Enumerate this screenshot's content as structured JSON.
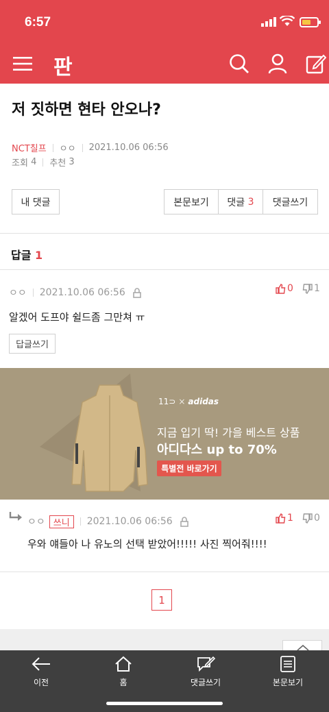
{
  "status_bar": {
    "time": "6:57"
  },
  "app_bar": {
    "logo": "판",
    "icons": [
      "menu-icon",
      "search-icon",
      "user-icon",
      "write-icon"
    ]
  },
  "post": {
    "title": "저 짓하면 현타 안오나?",
    "author": "NCT칠프",
    "nickname": "ㅇㅇ",
    "datetime": "2021.10.06 06:56",
    "views_label": "조회",
    "views": "4",
    "recommend_label": "추천",
    "recommend": "3"
  },
  "actions": {
    "my_comments": "내 댓글",
    "view_post": "본문보기",
    "comments_label": "댓글",
    "comments_count": "3",
    "write_comment": "댓글쓰기"
  },
  "replies": {
    "header_label": "답글",
    "header_count": "1"
  },
  "comments": [
    {
      "author": "ㅇㅇ",
      "datetime": "2021.10.06 06:56",
      "up": "0",
      "down": "1",
      "text": "알겠어 도프야 쉴드좀 그만쳐 ㅠ",
      "reply_button": "답글쓰기"
    },
    {
      "author": "ㅇㅇ",
      "badge": "쓰니",
      "datetime": "2021.10.06 06:56",
      "up": "1",
      "down": "0",
      "text": "우와 얘들아 나 유노의 선택 받았어!!!!! 사진 찍어줘!!!!"
    }
  ],
  "ad": {
    "brand_11": "11",
    "brand_x": "×",
    "brand_adidas": "adidas",
    "line1": "지금 입기 딱! 가을 베스트 상품",
    "line2": "아디다스 up to 70%",
    "cta": "특별전 바로가기"
  },
  "pagination": {
    "current": "1"
  },
  "bottom_nav": [
    {
      "label": "이전",
      "icon": "back-arrow-icon"
    },
    {
      "label": "홈",
      "icon": "home-icon"
    },
    {
      "label": "댓글쓰기",
      "icon": "comment-write-icon"
    },
    {
      "label": "본문보기",
      "icon": "document-icon"
    }
  ],
  "colors": {
    "brand": "#e3464d",
    "ad_bg": "#a89a7e",
    "bottom_bar": "#3f3f3f"
  }
}
